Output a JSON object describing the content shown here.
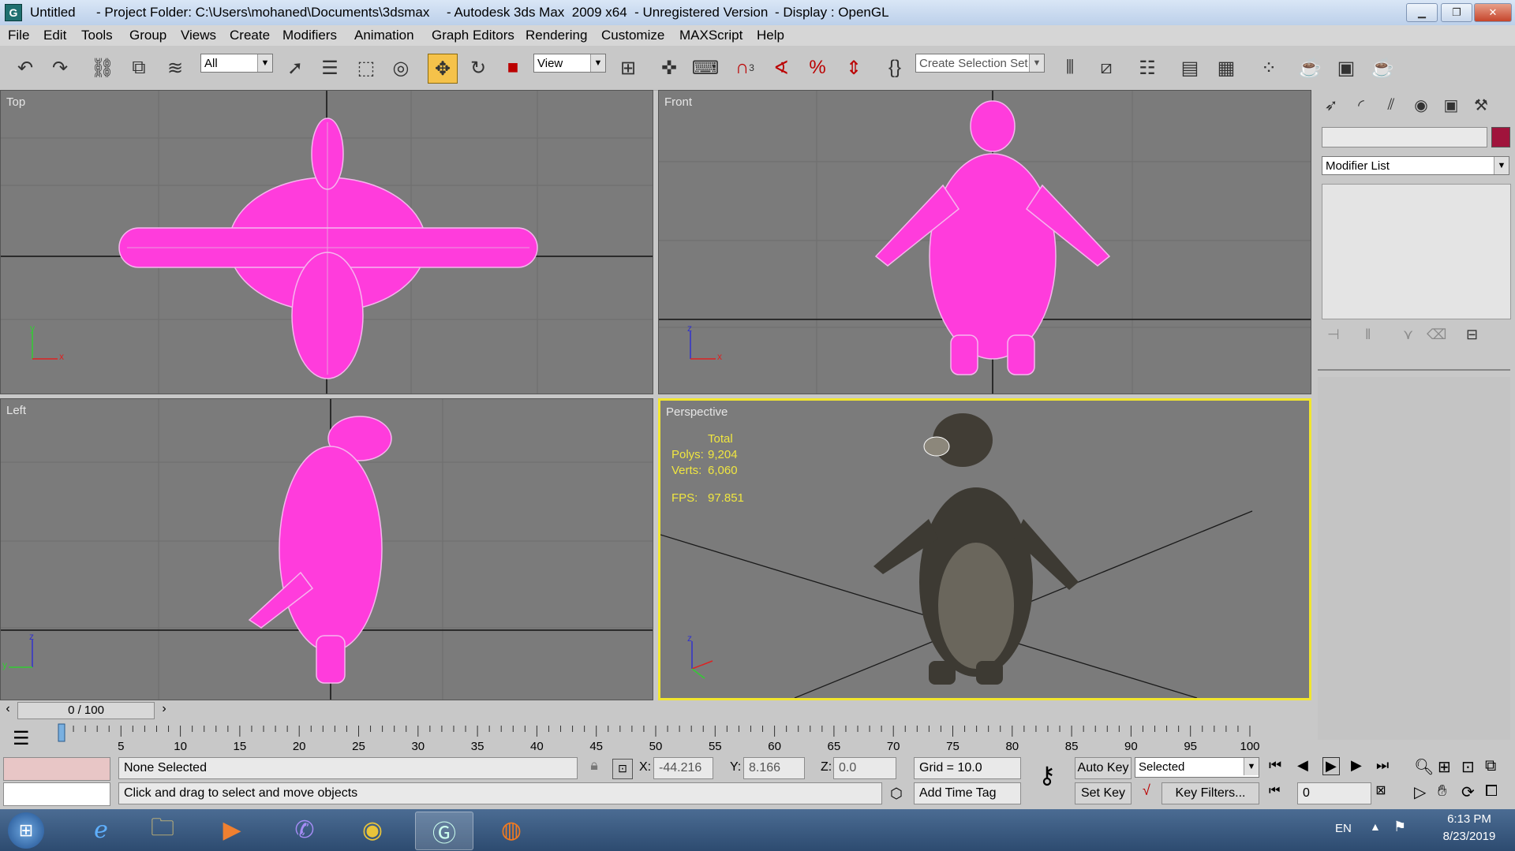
{
  "titlebar": {
    "app_icon": "3ds-max-icon",
    "title": "Untitled",
    "project": "- Project Folder: C:\\Users\\mohaned\\Documents\\3dsmax",
    "product": "- Autodesk 3ds Max  2009 x64  - Unregistered Version",
    "display": "- Display : OpenGL"
  },
  "menu": [
    "File",
    "Edit",
    "Tools",
    "Group",
    "Views",
    "Create",
    "Modifiers",
    "Animation",
    "Graph Editors",
    "Rendering",
    "Customize",
    "MAXScript",
    "Help"
  ],
  "toolbar": {
    "filter_value": "All",
    "refcoord_value": "View",
    "selection_set_placeholder": "Create Selection Set",
    "snap_label": "3"
  },
  "viewports": {
    "top": "Top",
    "front": "Front",
    "left": "Left",
    "perspective": "Perspective"
  },
  "stats": {
    "total_label": "Total",
    "polys_label": "Polys:",
    "polys_value": "9,204",
    "verts_label": "Verts:",
    "verts_value": "6,060",
    "fps_label": "FPS:",
    "fps_value": "97.851"
  },
  "axes": {
    "x": "x",
    "y": "y",
    "z": "z"
  },
  "command_panel": {
    "modifier_list": "Modifier List",
    "object_color": "#a0143c"
  },
  "time": {
    "frame_display": "0 / 100",
    "ticks": [
      "5",
      "10",
      "15",
      "20",
      "25",
      "30",
      "35",
      "40",
      "45",
      "50",
      "55",
      "60",
      "65",
      "70",
      "75",
      "80",
      "85",
      "90",
      "95",
      "100"
    ]
  },
  "status": {
    "selection": "None Selected",
    "prompt": "Click and drag to select and move objects",
    "x_label": "X:",
    "x_value": "-44.216",
    "y_label": "Y:",
    "y_value": "8.166",
    "z_label": "Z:",
    "z_value": "0.0",
    "grid": "Grid = 10.0",
    "add_time_tag": "Add Time Tag",
    "auto_key": "Auto Key",
    "set_key": "Set Key",
    "key_mode": "Selected",
    "key_filters": "Key Filters...",
    "current_frame": "0"
  },
  "taskbar": {
    "language": "EN",
    "time": "6:13 PM",
    "date": "8/23/2019"
  },
  "colors": {
    "wireframe": "#ff3cdc",
    "active_viewport": "#f2e62e",
    "stats_text": "#f0e640",
    "viewport_bg": "#7b7b7b"
  }
}
